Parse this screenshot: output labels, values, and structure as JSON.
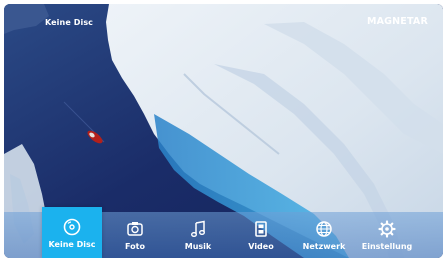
{
  "status": {
    "disc": "Keine Disc"
  },
  "brand": {
    "name": "MAGNETAR"
  },
  "menu": {
    "items": [
      {
        "label": "Keine Disc",
        "icon": "disc-icon",
        "active": true
      },
      {
        "label": "Foto",
        "icon": "photo-icon",
        "active": false
      },
      {
        "label": "Musik",
        "icon": "music-note-icon",
        "active": false
      },
      {
        "label": "Video",
        "icon": "film-icon",
        "active": false
      },
      {
        "label": "Netzwerk",
        "icon": "globe-icon",
        "active": false
      },
      {
        "label": "Einstellung",
        "icon": "gear-icon",
        "active": false
      }
    ]
  },
  "colors": {
    "active_tile": "#1bb2ee",
    "sea": "#1b2d66",
    "ice": "#dfe7f0",
    "boat": "#b3201b"
  }
}
